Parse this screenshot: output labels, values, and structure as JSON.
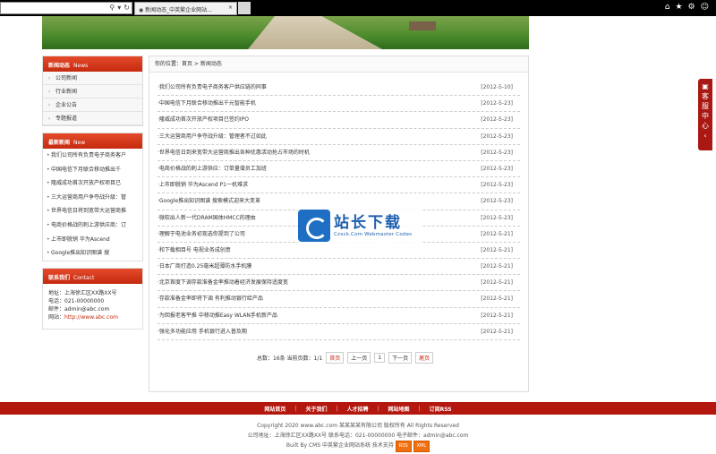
{
  "browser": {
    "tab_title": "新闻动态_中英繁企业网站...",
    "close_glyph": "×"
  },
  "sidebar": {
    "categories_title": "新闻动态",
    "categories_title_en": "News",
    "categories": [
      "公司新闻",
      "行业新闻",
      "企业公告",
      "专题报道"
    ],
    "latest_title": "最新新闻",
    "latest_title_en": "New",
    "latest": [
      "我们公司所有负责电子商务客户",
      "中国电信下月联合移动推出千",
      "隆威成功首次开放产权项目已",
      "三大运营商用户争夺战升级：管",
      "世界电信日将到宽带大运营商推",
      "电商价格战的刺上游供应商：订",
      "上市即脱销 华为Ascend",
      "Google推出知识图谱 搜"
    ],
    "contact_title": "联系我们",
    "contact_title_en": "Contact",
    "address": "地址：上海徐汇区XX路XX号",
    "phone": "电话：021-00000000",
    "email": "邮件：admin@abc.com",
    "site_label": "网站：",
    "site_link": "http://www.abc.com"
  },
  "main": {
    "breadcrumb": "你的位置：首页 > 新闻动态",
    "articles": [
      {
        "title": "·我们公司所有负责电子商务客户供应链的同事",
        "date": "[2012-5-10]"
      },
      {
        "title": "·中国电信下月联合移动推出千元智能手机",
        "date": "[2012-5-23]"
      },
      {
        "title": "·隆威成功首次开放产权项目已签约IPO",
        "date": "[2012-5-23]"
      },
      {
        "title": "·三大运营商用户争夺战升级：管理者不过如此",
        "date": "[2012-5-23]"
      },
      {
        "title": "·世界电信日到来宽带大运营商推出各种优惠活动抢占市场的时机",
        "date": "[2012-5-23]"
      },
      {
        "title": "·电商价格战的刺上游供应：订单量增员工加班",
        "date": "[2012-5-23]"
      },
      {
        "title": "·上市即脱销 华为Ascend P1一机难求",
        "date": "[2012-5-23]"
      },
      {
        "title": "·Google推出知识图谱 搜索模式迎来大变革",
        "date": "[2012-5-23]"
      },
      {
        "title": "·微软出人新一代DRAM国体HMCC的理由",
        "date": "[2012-5-23]"
      },
      {
        "title": "·理解于电池业务初现选你提到了公司",
        "date": "[2012-5-21]"
      },
      {
        "title": "·和下载相目号 电视业务成创意",
        "date": "[2012-5-21]"
      },
      {
        "title": "·日本厂商打造0.25毫米超薄防水手机膜",
        "date": "[2012-5-21]"
      },
      {
        "title": "·北京首度下调存款准备金率推动着经济发展保持适度宽",
        "date": "[2012-5-21]"
      },
      {
        "title": "·存款准备金率即将下调 有利推动银行给产品",
        "date": "[2012-5-21]"
      },
      {
        "title": "·为回报老客平推 中移动推Easy WLAN手机新产品",
        "date": "[2012-5-21]"
      },
      {
        "title": "·强化多功能应用 手机银行进入普及期",
        "date": "[2012-5-21]"
      }
    ],
    "pager": {
      "summary": "总数：16条  当前页数：1/1",
      "first": "首页",
      "prev": "上一页",
      "page": "1",
      "next": "下一页",
      "last": "尾页"
    }
  },
  "watermark": {
    "title": "站长下载",
    "subtitle": "Czxck.Com Webmaster Codes"
  },
  "float_label": [
    "客",
    "服",
    "中",
    "心"
  ],
  "float_arrow": "‹",
  "footer": {
    "nav": [
      "网站首页",
      "关于我们",
      "人才招聘",
      "网站地图",
      "订阅RSS"
    ],
    "copyright": "Copyright 2020 www.abc.com 某某某某有限公司 版权所有 All Rights Reserved",
    "address": "公司地址：上海徐汇区XX路XX号 联系电话：021-00000000 电子邮件：admin@abc.com",
    "powered": "Built By CMS 中英繁企业网站系统 技术支持",
    "badge_rss": "RSS",
    "badge_xml": "XML"
  },
  "colors": {
    "accent_red": "#c52a10",
    "footer_red": "#b3170d",
    "watermark_blue": "#1e6fc4"
  }
}
